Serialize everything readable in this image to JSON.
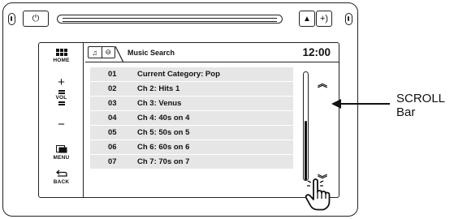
{
  "device": {
    "power_glyph": "⏻",
    "eject_glyph": "▲",
    "skip_glyph": "+)"
  },
  "sidebar": {
    "home_label": "HOME",
    "vol_label": "VOL",
    "vol_plus": "+",
    "vol_minus": "−",
    "menu_label": "MENU",
    "back_label": "BACK",
    "back_glyph": "⮌"
  },
  "header": {
    "icon_1": "♫",
    "icon_2": "⊖",
    "title": "Music Search",
    "clock": "12:00"
  },
  "list": {
    "items": [
      {
        "num": "01",
        "text": "Current Category: Pop"
      },
      {
        "num": "02",
        "text": "Ch 2: Hits 1"
      },
      {
        "num": "03",
        "text": "Ch 3: Venus"
      },
      {
        "num": "04",
        "text": "Ch 4: 40s on 4"
      },
      {
        "num": "05",
        "text": "Ch 5: 50s on 5"
      },
      {
        "num": "06",
        "text": "Ch 6: 60s on 6"
      },
      {
        "num": "07",
        "text": "Ch 7: 70s on 7"
      }
    ]
  },
  "scroll": {
    "up_glyph": "︽",
    "down_glyph": "︾",
    "thumb_start": 0.45,
    "thumb_end": 1.0
  },
  "callout": {
    "line1": "SCROLL",
    "line2": "Bar"
  }
}
